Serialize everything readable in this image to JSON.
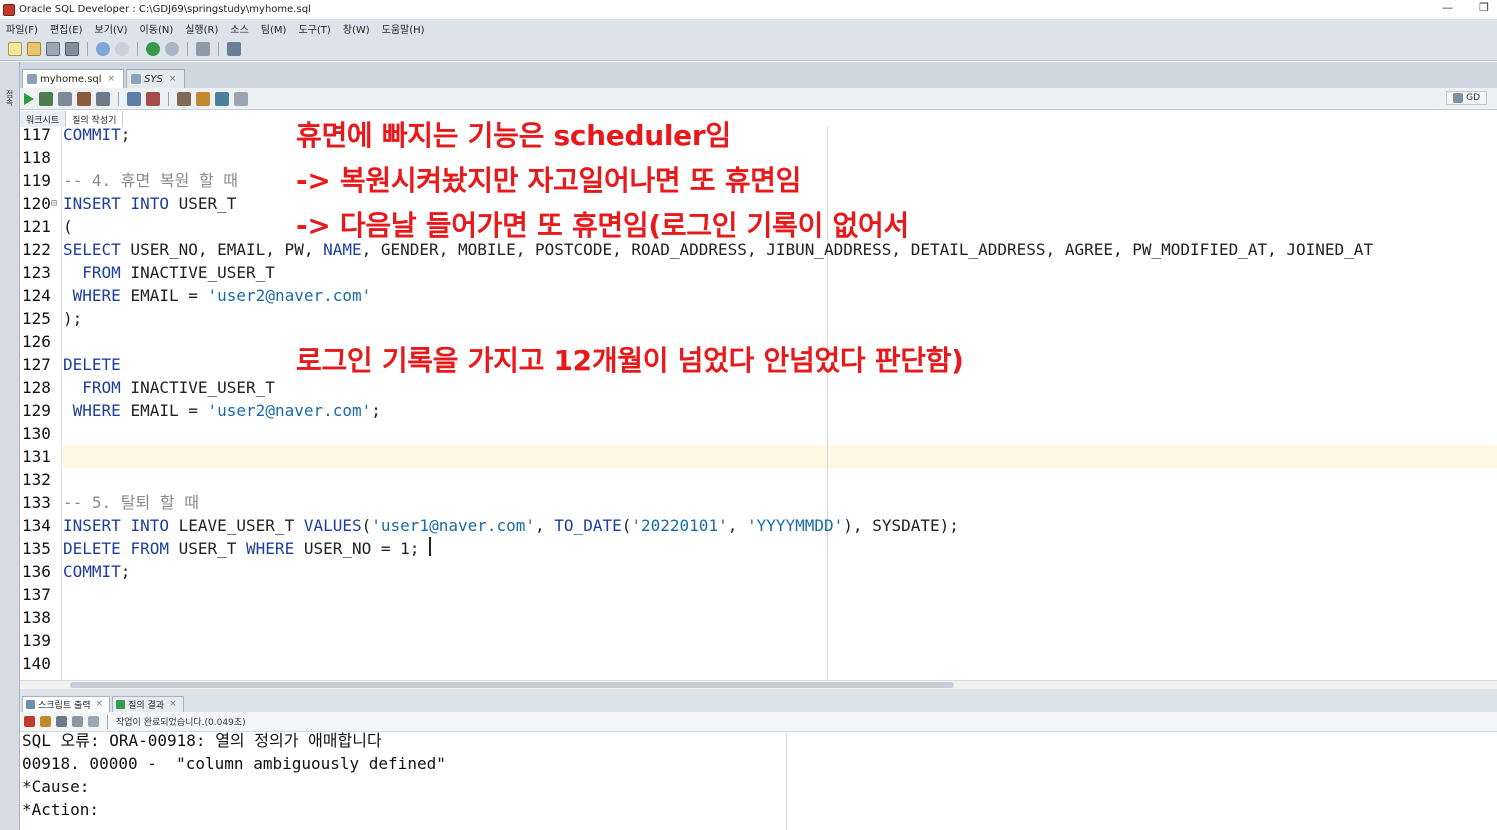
{
  "window": {
    "title": "Oracle SQL Developer : C:\\GDJ69\\springstudy\\myhome.sql",
    "min_label": "—",
    "restore_label": "❐"
  },
  "menubar": [
    "파일(F)",
    "편집(E)",
    "보기(V)",
    "이동(N)",
    "실행(R)",
    "소스",
    "팀(M)",
    "도구(T)",
    "창(W)",
    "도움말(H)"
  ],
  "left_strip": {
    "label": "접속"
  },
  "doc_tabs": [
    {
      "label": "myhome.sql",
      "active": true
    },
    {
      "label": "SYS",
      "active": false
    }
  ],
  "connection": {
    "label": "GD"
  },
  "sub_tabs": [
    "워크시트",
    "질의 작성기"
  ],
  "editor": {
    "lines": [
      {
        "n": "117",
        "text": "COMMIT;"
      },
      {
        "n": "118",
        "text": ""
      },
      {
        "n": "119",
        "text": "-- 4. 휴면 복원 할 때"
      },
      {
        "n": "120",
        "text": "INSERT INTO USER_T"
      },
      {
        "n": "121",
        "text": "("
      },
      {
        "n": "122",
        "text": "SELECT USER_NO, EMAIL, PW, NAME, GENDER, MOBILE, POSTCODE, ROAD_ADDRESS, JIBUN_ADDRESS, DETAIL_ADDRESS, AGREE, PW_MODIFIED_AT, JOINED_AT"
      },
      {
        "n": "123",
        "text": "  FROM INACTIVE_USER_T"
      },
      {
        "n": "124",
        "text": " WHERE EMAIL = 'user2@naver.com'"
      },
      {
        "n": "125",
        "text": ");"
      },
      {
        "n": "126",
        "text": ""
      },
      {
        "n": "127",
        "text": "DELETE"
      },
      {
        "n": "128",
        "text": "  FROM INACTIVE_USER_T"
      },
      {
        "n": "129",
        "text": " WHERE EMAIL = 'user2@naver.com';"
      },
      {
        "n": "130",
        "text": ""
      },
      {
        "n": "131",
        "text": ""
      },
      {
        "n": "132",
        "text": ""
      },
      {
        "n": "133",
        "text": "-- 5. 탈퇴 할 때"
      },
      {
        "n": "134",
        "text": "INSERT INTO LEAVE_USER_T VALUES('user1@naver.com', TO_DATE('20220101', 'YYYYMMDD'), SYSDATE);"
      },
      {
        "n": "135",
        "text": "DELETE FROM USER_T WHERE USER_NO = 1;"
      },
      {
        "n": "136",
        "text": "COMMIT;"
      },
      {
        "n": "137",
        "text": ""
      },
      {
        "n": "138",
        "text": ""
      },
      {
        "n": "139",
        "text": ""
      },
      {
        "n": "140",
        "text": ""
      }
    ]
  },
  "annotations": [
    "휴면에 빠지는 기능은 scheduler임",
    "-> 복원시켜놨지만 자고일어나면 또 휴면임",
    "-> 다음날 들어가면 또 휴면임(로그인 기록이 없어서",
    "로그인 기록을 가지고 12개월이 넘었다 안넘었다 판단함)"
  ],
  "output_tabs": [
    {
      "label": "스크립트 출력",
      "active": true
    },
    {
      "label": "질의 결과",
      "active": false
    }
  ],
  "output_status": "작업이 완료되었습니다.(0.049초)",
  "output_lines": [
    "SQL 오류: ORA-00918: 열의 정의가 애매합니다",
    "00918. 00000 -  \"column ambiguously defined\"",
    "*Cause:",
    "*Action:"
  ],
  "colors": {
    "keyword": "#1e3e9f",
    "string": "#1a6aa8",
    "comment": "#8a8a8a",
    "annotation": "#e8191b",
    "current_line": "#fdf6e3"
  }
}
